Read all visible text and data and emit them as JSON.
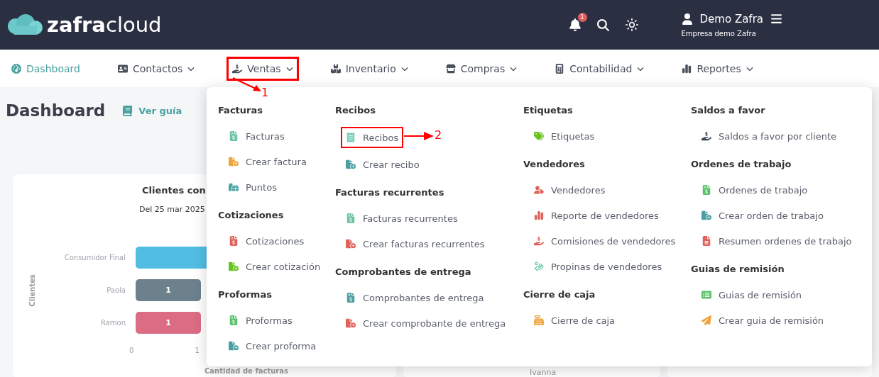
{
  "header": {
    "logo": {
      "bold": "zafra",
      "light": "cloud"
    },
    "notifications_badge": "1",
    "user_name": "Demo Zafra",
    "company": "Empresa demo Zafra"
  },
  "nav": [
    {
      "label": "Dashboard",
      "kind": "gauge",
      "selected": true,
      "dropdown": false,
      "highlighted": false
    },
    {
      "label": "Contactos",
      "kind": "card",
      "selected": false,
      "dropdown": true,
      "highlighted": false
    },
    {
      "label": "Ventas",
      "kind": "hand",
      "selected": false,
      "dropdown": true,
      "highlighted": true
    },
    {
      "label": "Inventario",
      "kind": "boxes",
      "selected": false,
      "dropdown": true,
      "highlighted": false
    },
    {
      "label": "Compras",
      "kind": "store",
      "selected": false,
      "dropdown": true,
      "highlighted": false
    },
    {
      "label": "Contabilidad",
      "kind": "calculator",
      "selected": false,
      "dropdown": true,
      "highlighted": false
    },
    {
      "label": "Reportes",
      "kind": "chart",
      "selected": false,
      "dropdown": true,
      "highlighted": false
    }
  ],
  "page": {
    "title": "Dashboard",
    "guide_link": "Ver guía"
  },
  "chart_card": {
    "title": "Clientes con",
    "subtitle": "Del 25 mar 2025",
    "ylabel": "Clientes",
    "xlabel": "Cantidad de facturas",
    "xticks": [
      "0",
      "1"
    ],
    "bars": [
      {
        "label": "Consumidor Final",
        "color": "#52bde3"
      },
      {
        "label": "Paola",
        "value_label": "1",
        "color": "#6c818c"
      },
      {
        "label": "Ramon",
        "value_label": "1",
        "color": "#dc6b84"
      }
    ]
  },
  "second_card": {
    "text": "Ivanna"
  },
  "dropdown": {
    "columns": [
      [
        {
          "heading": "Facturas",
          "items": [
            {
              "label": "Facturas",
              "kind": "invoice",
              "color": "#6cc3a0",
              "highlighted": false
            },
            {
              "label": "Crear factura",
              "kind": "create",
              "color": "#f0a53c",
              "highlighted": false
            },
            {
              "label": "Puntos",
              "kind": "gifts",
              "color": "#4aa3a0",
              "highlighted": false
            }
          ]
        },
        {
          "heading": "Cotizaciones",
          "items": [
            {
              "label": "Cotizaciones",
              "kind": "invoice",
              "color": "#e0625a",
              "highlighted": false
            },
            {
              "label": "Crear cotización",
              "kind": "create",
              "color": "#66c21d",
              "highlighted": false
            }
          ]
        },
        {
          "heading": "Proformas",
          "items": [
            {
              "label": "Proformas",
              "kind": "invoice",
              "color": "#5bc16a",
              "highlighted": false
            },
            {
              "label": "Crear proforma",
              "kind": "create",
              "color": "#4a9fa3",
              "highlighted": false
            }
          ]
        }
      ],
      [
        {
          "heading": "Recibos",
          "items": [
            {
              "label": "Recibos",
              "kind": "receipt",
              "color": "#7dd0b8",
              "highlighted": true
            },
            {
              "label": "Crear recibo",
              "kind": "create",
              "color": "#4a9fa3",
              "highlighted": false
            }
          ]
        },
        {
          "heading": "Facturas recurrentes",
          "items": [
            {
              "label": "Facturas recurrentes",
              "kind": "invoice",
              "color": "#6cc3a0",
              "highlighted": false
            },
            {
              "label": "Crear facturas recurrentes",
              "kind": "create",
              "color": "#e0625a",
              "highlighted": false
            }
          ]
        },
        {
          "heading": "Comprobantes de entrega",
          "items": [
            {
              "label": "Comprobantes de entrega",
              "kind": "invoice",
              "color": "#4a9fa3",
              "highlighted": false
            },
            {
              "label": "Crear comprobante de entrega",
              "kind": "create",
              "color": "#e0625a",
              "highlighted": false
            }
          ]
        }
      ],
      [
        {
          "heading": "Etiquetas",
          "items": [
            {
              "label": "Etiquetas",
              "kind": "tags",
              "color": "#66c21d",
              "highlighted": false
            }
          ]
        },
        {
          "heading": "Vendedores",
          "items": [
            {
              "label": "Vendedores",
              "kind": "user",
              "color": "#e0625a",
              "highlighted": false
            },
            {
              "label": "Reporte de vendedores",
              "kind": "chart",
              "color": "#e0625a",
              "highlighted": false
            },
            {
              "label": "Comisiones de vendedores",
              "kind": "hand",
              "color": "#e0625a",
              "highlighted": false
            },
            {
              "label": "Propinas de vendedores",
              "kind": "coins",
              "color": "#5cc9a0",
              "highlighted": false
            }
          ]
        },
        {
          "heading": "Cierre de caja",
          "items": [
            {
              "label": "Cierre de caja",
              "kind": "register",
              "color": "#f0a53c",
              "highlighted": false
            }
          ]
        }
      ],
      [
        {
          "heading": "Saldos a favor",
          "items": [
            {
              "label": "Saldos a favor por cliente",
              "kind": "hand",
              "color": "#3d4a5c",
              "highlighted": false
            }
          ]
        },
        {
          "heading": "Ordenes de trabajo",
          "items": [
            {
              "label": "Ordenes de trabajo",
              "kind": "invoice",
              "color": "#5bc16a",
              "highlighted": false
            },
            {
              "label": "Crear orden de trabajo",
              "kind": "create",
              "color": "#4a9fa3",
              "highlighted": false
            },
            {
              "label": "Resumen ordenes de trabajo",
              "kind": "file",
              "color": "#e0625a",
              "highlighted": false
            }
          ]
        },
        {
          "heading": "Guias de remisión",
          "items": [
            {
              "label": "Guias de remisión",
              "kind": "list",
              "color": "#5bc16a",
              "highlighted": false
            },
            {
              "label": "Crear guia de remisión",
              "kind": "send",
              "color": "#f0a53c",
              "highlighted": false
            }
          ]
        }
      ]
    ]
  },
  "annotations": [
    "1",
    "2"
  ]
}
